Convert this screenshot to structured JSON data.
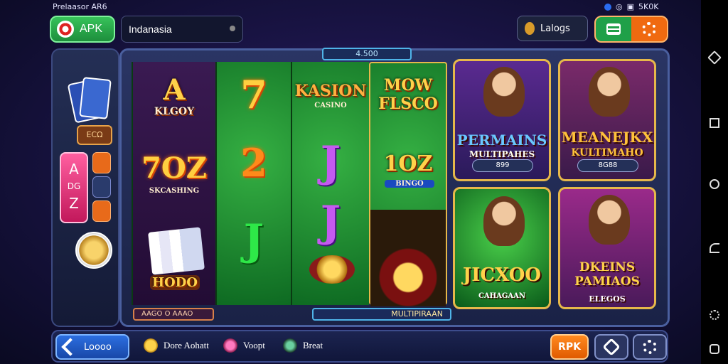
{
  "status_bar": {
    "left_text": "Prelaasor AR6",
    "right_text": "5K0K"
  },
  "top_bar": {
    "apk_label": "APK",
    "region_value": "Indanasia",
    "language_label": "Laloɡs"
  },
  "side_panel": {
    "badge": "ECΩ",
    "az_top": "A",
    "az_mid": "DG",
    "az_bot": "Z"
  },
  "frame": {
    "title": "4.500"
  },
  "reels": {
    "r1": {
      "top": "A",
      "top_caption": "KLGOY",
      "mid": "7OZ",
      "mid_caption": "SKCASHING",
      "bot_caption": "HODO"
    },
    "r2": {
      "top": "7",
      "mid": "2",
      "bot": "J"
    },
    "r3": {
      "top": "KASION",
      "top_caption": "CASINO",
      "mid": "J",
      "bot": "J"
    },
    "r4": {
      "top": "MOW FLSCO",
      "mid": "1OZ",
      "mid_caption": "BINGO"
    }
  },
  "cards": [
    {
      "title": "PERMAINS",
      "subtitle": "MULTIPAHES",
      "pill": "899"
    },
    {
      "title": "MEANEJKX",
      "subtitle": "KULTIMAHO",
      "pill": "8G88"
    },
    {
      "title": "JICXOO",
      "subtitle": "CAHAGAAN",
      "pill": ""
    },
    {
      "title": "DKEINS PAMIAOS",
      "subtitle": "ELEGOS",
      "pill": ""
    }
  ],
  "strips": {
    "left": "AAGO O AAAO",
    "right": "MULTIPIRAAN"
  },
  "bottom_bar": {
    "back_label": "Loooo",
    "nav": [
      "Dore Aohatt",
      "Voopt",
      "Breat"
    ],
    "rpk_label": "RPK"
  },
  "icons": [
    "chip-icon",
    "chevron-down-icon",
    "globe-icon",
    "menu-icon",
    "gear-icon",
    "arrow-back-icon",
    "coin-icon",
    "puzzle-icon"
  ]
}
